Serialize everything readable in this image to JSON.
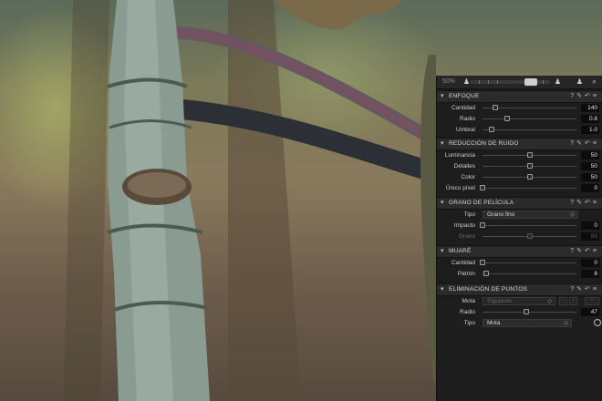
{
  "panel": {
    "zoom_label": "50%",
    "sections": {
      "enfoque": {
        "title": "ENFOQUE",
        "rows": [
          {
            "label": "Cantidad",
            "value": "140",
            "level": 0.14
          },
          {
            "label": "Radio",
            "value": "0.8",
            "level": 0.26
          },
          {
            "label": "Umbral",
            "value": "1.0",
            "level": 0.1
          }
        ]
      },
      "ruido": {
        "title": "REDUCCIÓN DE RUIDO",
        "rows": [
          {
            "label": "Luminancia",
            "value": "50",
            "level": 0.5
          },
          {
            "label": "Detalles",
            "value": "50",
            "level": 0.5
          },
          {
            "label": "Color",
            "value": "50",
            "level": 0.5
          },
          {
            "label": "Único píxel",
            "value": "0",
            "level": 0.0
          }
        ]
      },
      "grano": {
        "title": "GRANO DE PELÍCULA",
        "tipo_label": "Tipo",
        "tipo_value": "Grano fino",
        "rows": [
          {
            "label": "Impacto",
            "value": "0",
            "level": 0.0
          },
          {
            "label": "Grano",
            "value": "50",
            "level": 0.5,
            "disabled": true
          }
        ]
      },
      "muare": {
        "title": "MUARÉ",
        "rows": [
          {
            "label": "Cantidad",
            "value": "0",
            "level": 0.0
          },
          {
            "label": "Patrón",
            "value": "8",
            "level": 0.04
          }
        ]
      },
      "puntos": {
        "title": "ELIMINACIÓN DE PUNTOS",
        "mota_label": "Mota",
        "mota_value": "Siguiente",
        "radio_label": "Radio",
        "radio_value": "47",
        "radio_level": 0.47,
        "tipo_label": "Tipo",
        "tipo_value": "Mota"
      }
    }
  },
  "colors": {
    "panel_bg": "#1d1d1d",
    "header_bg": "#2b2b2b",
    "value_bg": "#0c0c0c"
  }
}
